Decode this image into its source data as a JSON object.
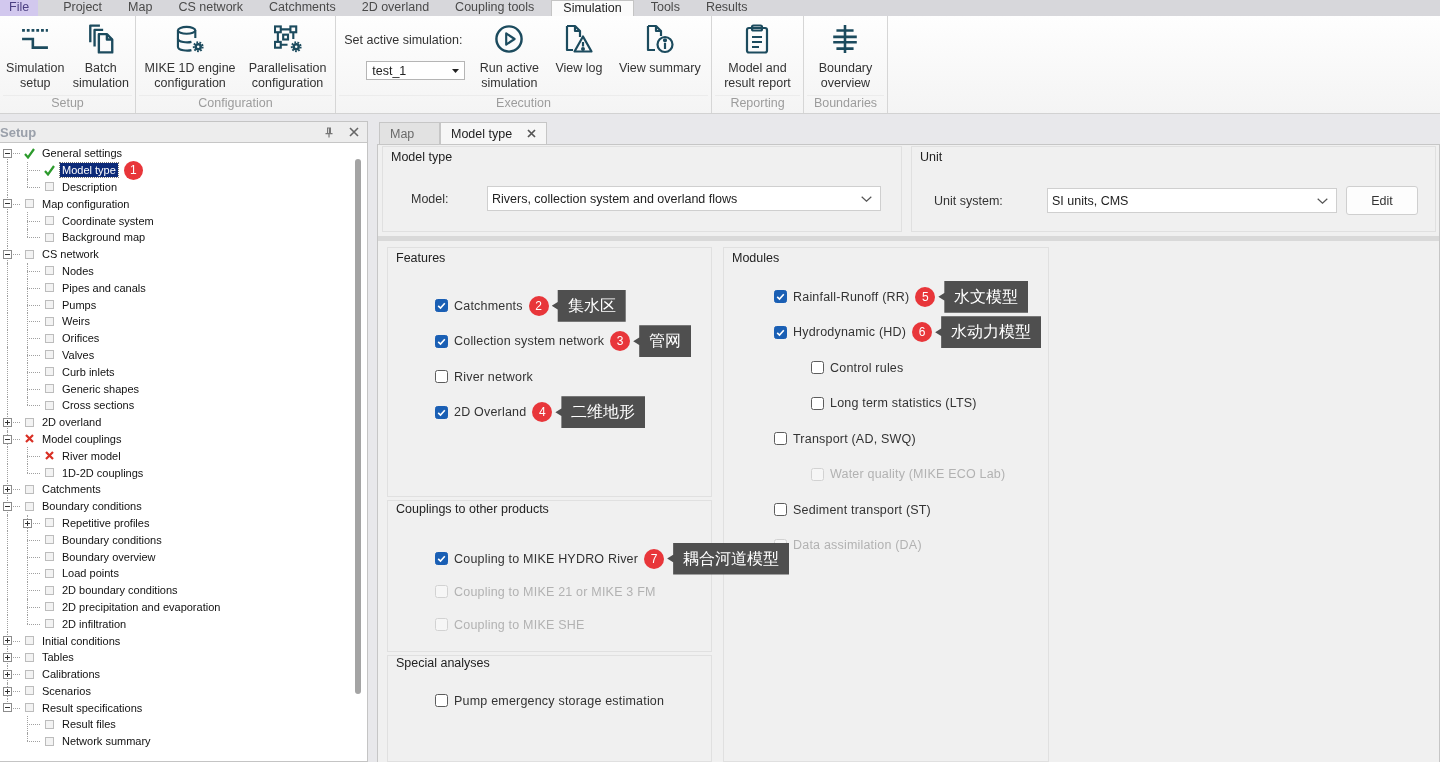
{
  "menu_tabs": [
    {
      "label": "File",
      "kind": "file",
      "selected": false
    },
    {
      "label": "Project",
      "kind": "tab",
      "selected": false
    },
    {
      "label": "Map",
      "kind": "tab",
      "selected": false
    },
    {
      "label": "CS network",
      "kind": "tab",
      "selected": false
    },
    {
      "label": "Catchments",
      "kind": "tab",
      "selected": false
    },
    {
      "label": "2D overland",
      "kind": "tab",
      "selected": false
    },
    {
      "label": "Coupling tools",
      "kind": "tab",
      "selected": false
    },
    {
      "label": "Simulation",
      "kind": "tab",
      "selected": true
    },
    {
      "label": "Tools",
      "kind": "tab",
      "selected": false
    },
    {
      "label": "Results",
      "kind": "tab",
      "selected": false
    }
  ],
  "ribbon": {
    "groups": [
      {
        "label": "Setup",
        "items": [
          {
            "kind": "button",
            "label": "Simulation\nsetup"
          },
          {
            "kind": "button",
            "label": "Batch\nsimulation"
          }
        ]
      },
      {
        "label": "Configuration",
        "items": [
          {
            "kind": "button",
            "label": "MIKE 1D engine\nconfiguration"
          },
          {
            "kind": "button",
            "label": "Parallelisation\nconfiguration"
          }
        ]
      },
      {
        "label": "Execution",
        "items": [
          {
            "kind": "select",
            "label": "Set active simulation:",
            "value": "test_1"
          },
          {
            "kind": "button",
            "label": "Run active\nsimulation"
          },
          {
            "kind": "button",
            "label": "View log"
          },
          {
            "kind": "button",
            "label": "View summary"
          }
        ]
      },
      {
        "label": "Reporting",
        "items": [
          {
            "kind": "button",
            "label": "Model and\nresult report"
          }
        ]
      },
      {
        "label": "Boundaries",
        "items": [
          {
            "kind": "button",
            "label": "Boundary\noverview"
          }
        ]
      }
    ]
  },
  "setup_panel": {
    "title": "Setup",
    "tree": [
      {
        "label": "General settings",
        "kind": "ok",
        "expanded": true,
        "selected": false,
        "children": [
          {
            "label": "Model type",
            "kind": "ok",
            "selected": true,
            "badge": "1"
          },
          {
            "label": "Description",
            "kind": "empty",
            "selected": false
          }
        ]
      },
      {
        "label": "Map configuration",
        "kind": "empty",
        "expanded": true,
        "selected": false,
        "children": [
          {
            "label": "Coordinate system",
            "kind": "empty",
            "selected": false
          },
          {
            "label": "Background map",
            "kind": "empty",
            "selected": false
          }
        ]
      },
      {
        "label": "CS network",
        "kind": "empty",
        "expanded": true,
        "selected": false,
        "children": [
          {
            "label": "Nodes",
            "kind": "empty",
            "selected": false
          },
          {
            "label": "Pipes and canals",
            "kind": "empty",
            "selected": false
          },
          {
            "label": "Pumps",
            "kind": "empty",
            "selected": false
          },
          {
            "label": "Weirs",
            "kind": "empty",
            "selected": false
          },
          {
            "label": "Orifices",
            "kind": "empty",
            "selected": false
          },
          {
            "label": "Valves",
            "kind": "empty",
            "selected": false
          },
          {
            "label": "Curb inlets",
            "kind": "empty",
            "selected": false
          },
          {
            "label": "Generic shapes",
            "kind": "empty",
            "selected": false
          },
          {
            "label": "Cross sections",
            "kind": "empty",
            "selected": false
          }
        ]
      },
      {
        "label": "2D overland",
        "kind": "empty",
        "expanded": false,
        "selected": false
      },
      {
        "label": "Model couplings",
        "kind": "error",
        "expanded": true,
        "selected": false,
        "children": [
          {
            "label": "River model",
            "kind": "error",
            "selected": false
          },
          {
            "label": "1D-2D couplings",
            "kind": "empty",
            "selected": false
          }
        ]
      },
      {
        "label": "Catchments",
        "kind": "empty",
        "expanded": false,
        "selected": false
      },
      {
        "label": "Boundary conditions",
        "kind": "empty",
        "expanded": true,
        "selected": false,
        "children": [
          {
            "label": "Repetitive profiles",
            "kind": "empty",
            "expanded": false,
            "selected": false
          },
          {
            "label": "Boundary conditions",
            "kind": "empty",
            "selected": false
          },
          {
            "label": "Boundary overview",
            "kind": "empty",
            "selected": false
          },
          {
            "label": "Load points",
            "kind": "empty",
            "selected": false
          },
          {
            "label": "2D boundary conditions",
            "kind": "empty",
            "selected": false
          },
          {
            "label": "2D precipitation and evaporation",
            "kind": "empty",
            "selected": false
          },
          {
            "label": "2D infiltration",
            "kind": "empty",
            "selected": false
          }
        ]
      },
      {
        "label": "Initial conditions",
        "kind": "empty",
        "expanded": false,
        "selected": false
      },
      {
        "label": "Tables",
        "kind": "empty",
        "expanded": false,
        "selected": false
      },
      {
        "label": "Calibrations",
        "kind": "empty",
        "expanded": false,
        "selected": false
      },
      {
        "label": "Scenarios",
        "kind": "empty",
        "expanded": false,
        "selected": false
      },
      {
        "label": "Result specifications",
        "kind": "empty",
        "expanded": true,
        "selected": false,
        "children": [
          {
            "label": "Result files",
            "kind": "empty",
            "selected": false
          },
          {
            "label": "Network summary",
            "kind": "empty",
            "selected": false
          }
        ]
      }
    ]
  },
  "document_tabs": [
    {
      "label": "Map",
      "selected": false,
      "closable": false
    },
    {
      "label": "Model type",
      "selected": true,
      "closable": true
    }
  ],
  "model_type": {
    "title": "Model type",
    "label": "Model:",
    "value": "Rivers, collection system and overland flows"
  },
  "unit": {
    "title": "Unit",
    "label": "Unit system:",
    "value": "SI units, CMS",
    "button": "Edit"
  },
  "features": {
    "title": "Features",
    "items": [
      {
        "label": "Catchments",
        "checked": true,
        "badge": "2",
        "note": "集水区"
      },
      {
        "label": "Collection system network",
        "checked": true,
        "badge": "3",
        "note": "管网"
      },
      {
        "label": "River network",
        "checked": false
      },
      {
        "label": "2D Overland",
        "checked": true,
        "badge": "4",
        "note": "二维地形"
      }
    ]
  },
  "couplings": {
    "title": "Couplings to other products",
    "items": [
      {
        "label": "Coupling to MIKE HYDRO River",
        "checked": true,
        "disabled": false,
        "badge": "7",
        "note": "耦合河道模型"
      },
      {
        "label": "Coupling to MIKE 21 or MIKE 3 FM",
        "checked": false,
        "disabled": true
      },
      {
        "label": "Coupling to MIKE SHE",
        "checked": false,
        "disabled": true
      }
    ]
  },
  "special_analyses": {
    "title": "Special analyses",
    "items": [
      {
        "label": "Pump emergency storage estimation",
        "checked": false
      }
    ]
  },
  "modules": {
    "title": "Modules",
    "items": [
      {
        "label": "Rainfall-Runoff (RR)",
        "checked": true,
        "disabled": false,
        "badge": "5",
        "note": "水文模型"
      },
      {
        "label": "Hydrodynamic (HD)",
        "checked": true,
        "disabled": false,
        "badge": "6",
        "note": "水动力模型",
        "children": [
          {
            "label": "Control rules",
            "checked": false,
            "disabled": false
          },
          {
            "label": "Long term statistics (LTS)",
            "checked": false,
            "disabled": false
          }
        ]
      },
      {
        "label": "Transport (AD, SWQ)",
        "checked": false,
        "disabled": false,
        "children": [
          {
            "label": "Water quality (MIKE ECO Lab)",
            "checked": false,
            "disabled": true
          }
        ]
      },
      {
        "label": "Sediment transport (ST)",
        "checked": false,
        "disabled": false
      },
      {
        "label": "Data assimilation (DA)",
        "checked": false,
        "disabled": true
      }
    ]
  }
}
